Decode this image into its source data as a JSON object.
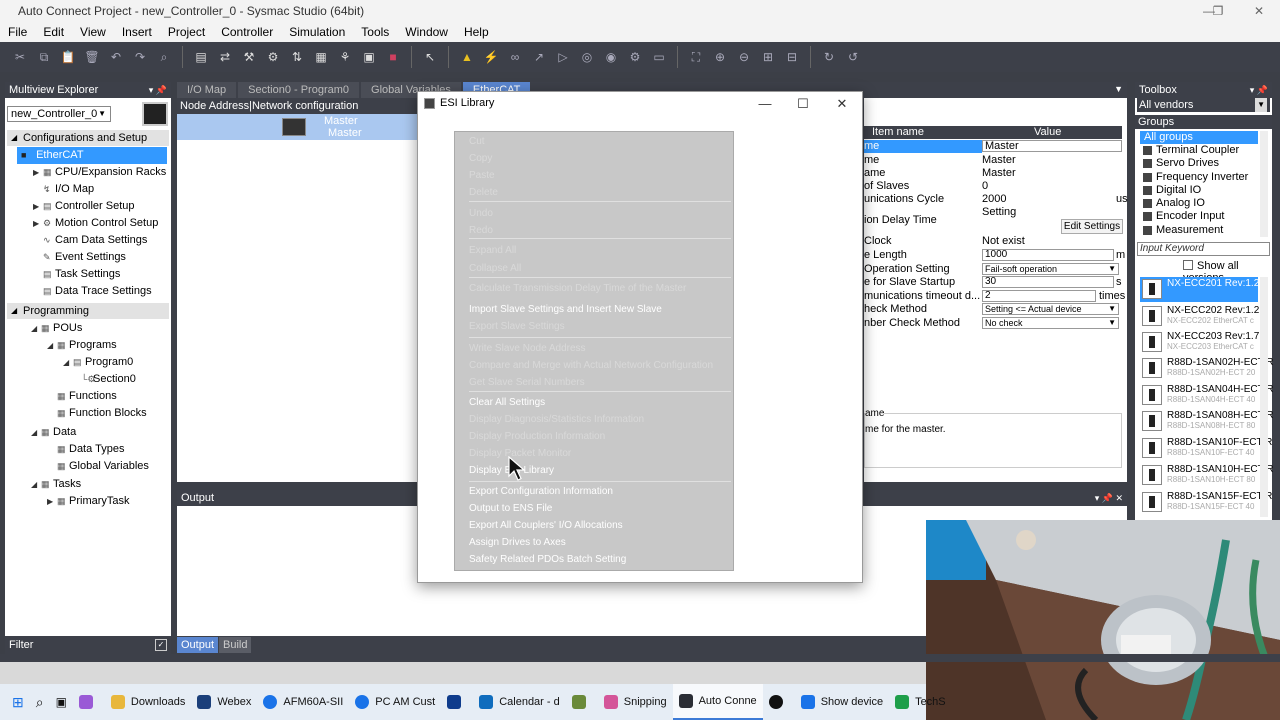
{
  "window": {
    "title": "Auto Connect Project - new_Controller_0 - Sysmac Studio (64bit)",
    "minimize": "—",
    "maximize": "❐",
    "close": "✕"
  },
  "menu": [
    "File",
    "Edit",
    "View",
    "Insert",
    "Project",
    "Controller",
    "Simulation",
    "Tools",
    "Window",
    "Help"
  ],
  "multiview": {
    "title": "Multiview Explorer",
    "controller": "new_Controller_0",
    "config_header": "Configurations and Setup",
    "config_items": [
      {
        "label": "EtherCAT",
        "selected": true
      },
      {
        "label": "CPU/Expansion Racks",
        "expandable": true
      },
      {
        "label": "I/O Map"
      },
      {
        "label": "Controller Setup",
        "expandable": true
      },
      {
        "label": "Motion Control Setup",
        "expandable": true
      },
      {
        "label": "Cam Data Settings"
      },
      {
        "label": "Event Settings"
      },
      {
        "label": "Task Settings"
      },
      {
        "label": "Data Trace Settings"
      }
    ],
    "programming_header": "Programming",
    "programming_items": [
      "POUs",
      "Programs",
      "Program0",
      "Section0",
      "Functions",
      "Function Blocks",
      "Data",
      "Data Types",
      "Global Variables",
      "Tasks",
      "PrimaryTask"
    ],
    "filter": "Filter"
  },
  "tabs": [
    "I/O Map",
    "Section0 - Program0",
    "Global Variables",
    "EtherCAT"
  ],
  "network": {
    "header": "Node Address|Network configuration",
    "master_line1": "Master",
    "master_line2": "Master"
  },
  "properties": {
    "col_name": "Item name",
    "col_value": "Value",
    "rows": [
      {
        "name": "me",
        "value": "Master",
        "kind": "box"
      },
      {
        "name": "me",
        "value": "Master"
      },
      {
        "name": "ame",
        "value": "Master"
      },
      {
        "name": "of Slaves",
        "value": "0"
      },
      {
        "name": "unications Cycle",
        "value": "2000",
        "unit": "us"
      },
      {
        "name": "ion Delay Time",
        "value": "Setting"
      },
      {
        "name": "Clock",
        "value": "Not exist"
      },
      {
        "name": "e Length",
        "value": "1000",
        "kind": "box",
        "unit": "m"
      },
      {
        "name": "Operation Setting",
        "value": "Fail-soft operation",
        "kind": "dd"
      },
      {
        "name": "e for Slave Startup",
        "value": "30",
        "kind": "box",
        "unit": "s"
      },
      {
        "name": "munications timeout d...",
        "value": "2",
        "kind": "box",
        "unit": "times"
      },
      {
        "name": "heck Method",
        "value": "Setting <= Actual device",
        "kind": "dd"
      },
      {
        "name": "nber Check Method",
        "value": "No check",
        "kind": "dd"
      }
    ],
    "edit_settings": "Edit Settings",
    "desc_title": "ame",
    "desc_text": "me for the master."
  },
  "output": {
    "title": "Output",
    "tab_output": "Output",
    "tab_build": "Build"
  },
  "toolbox": {
    "title": "Toolbox",
    "vendors": "All vendors",
    "groups_title": "Groups",
    "groups": [
      "All groups",
      "Terminal Coupler",
      "Servo Drives",
      "Frequency Inverter",
      "Digital IO",
      "Analog IO",
      "Encoder Input",
      "Measurement Sensor"
    ],
    "keyword": "Input Keyword",
    "show_all": "Show all versions",
    "devices": [
      {
        "name": "NX-ECC201 Rev:1.2",
        "sub": "",
        "selected": true
      },
      {
        "name": "NX-ECC202 Rev:1.2",
        "sub": "NX-ECC202 EtherCAT c"
      },
      {
        "name": "NX-ECC203 Rev:1.7",
        "sub": "NX-ECC203 EtherCAT c"
      },
      {
        "name": "R88D-1SAN02H-ECT R",
        "sub": "R88D-1SAN02H-ECT 20"
      },
      {
        "name": "R88D-1SAN04H-ECT R",
        "sub": "R88D-1SAN04H-ECT 40"
      },
      {
        "name": "R88D-1SAN08H-ECT R",
        "sub": "R88D-1SAN08H-ECT 80"
      },
      {
        "name": "R88D-1SAN10F-ECT R",
        "sub": "R88D-1SAN10F-ECT 40"
      },
      {
        "name": "R88D-1SAN10H-ECT R",
        "sub": "R88D-1SAN10H-ECT 80"
      },
      {
        "name": "R88D-1SAN15F-ECT R",
        "sub": "R88D-1SAN15F-ECT 40"
      }
    ]
  },
  "dialog": {
    "title": "ESI Library",
    "min": "—",
    "max": "☐",
    "close": "✕"
  },
  "context_menu": [
    {
      "label": "Cut",
      "enabled": false
    },
    {
      "label": "Copy",
      "enabled": false
    },
    {
      "label": "Paste",
      "enabled": false
    },
    {
      "label": "Delete",
      "enabled": false
    },
    {
      "sep": true
    },
    {
      "label": "Undo",
      "enabled": false
    },
    {
      "label": "Redo",
      "enabled": false
    },
    {
      "sep": true
    },
    {
      "label": "Expand All",
      "enabled": false
    },
    {
      "label": "Collapse All",
      "enabled": false
    },
    {
      "sep": true
    },
    {
      "label": "Calculate Transmission Delay Time of the Master",
      "enabled": false
    },
    {
      "label": "Import Slave Settings and Insert New Slave",
      "enabled": true
    },
    {
      "label": "Export Slave Settings",
      "enabled": false
    },
    {
      "sep": true
    },
    {
      "label": "Write Slave Node Address",
      "enabled": false
    },
    {
      "label": "Compare and Merge with Actual Network Configuration",
      "enabled": false
    },
    {
      "label": "Get Slave Serial Numbers",
      "enabled": false
    },
    {
      "sep": true
    },
    {
      "label": "Clear All Settings",
      "enabled": true
    },
    {
      "label": "Display Diagnosis/Statistics Information",
      "enabled": false
    },
    {
      "label": "Display Production Information",
      "enabled": false
    },
    {
      "label": "Display Packet Monitor",
      "enabled": false
    },
    {
      "label": "Display ESI Library",
      "enabled": true
    },
    {
      "sep": true
    },
    {
      "label": "Export Configuration Information",
      "enabled": true
    },
    {
      "label": "Output to ENS File",
      "enabled": true
    },
    {
      "label": "Export All Couplers' I/O Allocations",
      "enabled": true
    },
    {
      "label": "Assign Drives to Axes",
      "enabled": true
    },
    {
      "label": "Safety Related PDOs Batch Setting",
      "enabled": true
    }
  ],
  "taskbar": [
    {
      "label": "Downloads",
      "color": "#e8b73c"
    },
    {
      "label": "Webex",
      "color": "#1b3f7a"
    },
    {
      "label": "AFM60A-SII",
      "color": "#1a73e8"
    },
    {
      "label": "PC AM Cust",
      "color": "#1a73e8"
    },
    {
      "label": "Calendar - d",
      "color": "#0f6cbd"
    },
    {
      "label": "Snipping",
      "color": "#d45599"
    },
    {
      "label": "Auto Conne",
      "color": "#2a2d35",
      "active": true
    },
    {
      "label": "Show device",
      "color": "#1a73e8"
    },
    {
      "label": "TechS",
      "color": "#1e9e4a"
    }
  ],
  "colors": {
    "dark_panel": "#3d4049",
    "selection": "#3399ff",
    "tab_active": "#5a86d0",
    "context_bg": "#c8c8c8"
  }
}
